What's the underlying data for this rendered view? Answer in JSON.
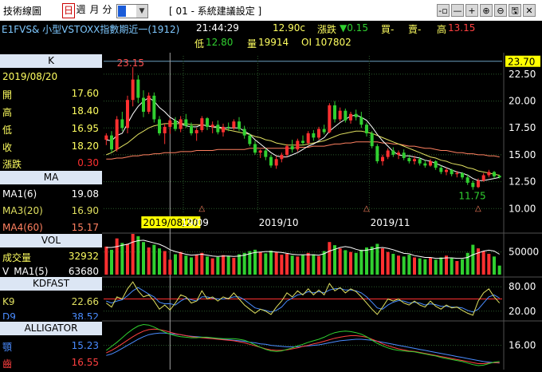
{
  "titlebar": {
    "title": "技術線圖",
    "period_day": "日",
    "period_week": "週",
    "period_month": "月",
    "period_minute": "分",
    "setting": "[ 01 - 系統建議設定 ]",
    "buttons": [
      "-▫",
      "—",
      "+",
      "⊕",
      "⊖",
      "🖫",
      "✕"
    ]
  },
  "quote": {
    "symbol": "E1FVS& 小型VSTOXX指數期近一(1912)",
    "time": "21:44:29",
    "price": "12.90c",
    "change_label": "漲跌",
    "change": "▼0.15",
    "buy": "買-",
    "sell": "賣-",
    "high_label": "高",
    "high": "13.15",
    "low_label": "低",
    "low": "12.80",
    "volume_label": "量",
    "volume": "19914",
    "oi_label": "OI",
    "oi": "107802"
  },
  "k_panel": {
    "header": "K",
    "date": "2019/08/20",
    "rows": [
      {
        "label": "開",
        "value": "17.60"
      },
      {
        "label": "高",
        "value": "18.40"
      },
      {
        "label": "低",
        "value": "16.95"
      },
      {
        "label": "收",
        "value": "18.20"
      },
      {
        "label": "漲跌",
        "value": "0.30"
      }
    ]
  },
  "ma_panel": {
    "header": "MA",
    "rows": [
      {
        "label": "MA1(6)",
        "value": "19.08"
      },
      {
        "label": "MA3(20)",
        "value": "16.90"
      },
      {
        "label": "MA4(60)",
        "value": "15.17"
      }
    ]
  },
  "vol_panel": {
    "header": "VOL",
    "rows": [
      {
        "label": "成交量",
        "value": "32932"
      },
      {
        "label": "V_MA1(5)",
        "value": "63680"
      }
    ]
  },
  "kd_panel": {
    "header": "KDFAST",
    "rows": [
      {
        "label": "K9",
        "value": "22.66"
      },
      {
        "label": "D9",
        "value": "38.52"
      }
    ]
  },
  "alligator_panel": {
    "header": "ALLIGATOR",
    "rows": [
      {
        "label": "顎",
        "value": "15.23"
      },
      {
        "label": "齒",
        "value": "16.55"
      }
    ]
  },
  "colors": {
    "up": "#ff3030",
    "down": "#30d030",
    "ma1": "#ffffff",
    "ma3": "#e0e060",
    "ma4": "#ff8060",
    "grid": "#2a5a2a",
    "axis_highlight": "#ffff00"
  },
  "chart_data": {
    "type": "candlestick",
    "price_axis": {
      "ticks": [
        "22.50",
        "20.00",
        "17.50",
        "15.00",
        "12.50",
        "10.00"
      ],
      "ylim": [
        9.5,
        24.2
      ],
      "current": "23.70"
    },
    "date_labels": [
      "2019/08/20",
      "19/09",
      "2019/10",
      "2019/11"
    ],
    "cursor_date": "2019/08/20",
    "annotation_high": "23.15",
    "annotation_low": "11.75",
    "candles": [
      [
        16.4,
        17.0,
        15.9,
        16.8
      ],
      [
        16.8,
        17.2,
        15.2,
        15.5
      ],
      [
        15.5,
        18.6,
        15.3,
        18.3
      ],
      [
        18.3,
        19.0,
        17.2,
        17.5
      ],
      [
        17.5,
        20.5,
        17.0,
        20.1
      ],
      [
        20.1,
        23.15,
        19.5,
        22.0
      ],
      [
        22.0,
        22.4,
        19.8,
        20.3
      ],
      [
        20.3,
        21.0,
        18.5,
        19.0
      ],
      [
        19.0,
        20.8,
        18.8,
        20.5
      ],
      [
        20.5,
        20.8,
        18.0,
        18.3
      ],
      [
        18.3,
        18.6,
        16.8,
        17.0
      ],
      [
        17.0,
        17.9,
        16.0,
        17.6
      ],
      [
        17.6,
        18.4,
        16.95,
        18.2
      ],
      [
        18.2,
        18.5,
        17.2,
        17.4
      ],
      [
        17.4,
        18.6,
        17.1,
        18.3
      ],
      [
        18.3,
        18.8,
        17.5,
        17.7
      ],
      [
        17.7,
        18.0,
        16.8,
        17.0
      ],
      [
        17.0,
        17.5,
        16.3,
        17.3
      ],
      [
        17.3,
        18.6,
        17.1,
        18.4
      ],
      [
        18.4,
        18.5,
        17.3,
        17.6
      ],
      [
        17.6,
        18.1,
        17.0,
        17.8
      ],
      [
        17.8,
        18.2,
        16.9,
        17.1
      ],
      [
        17.1,
        17.9,
        16.7,
        17.6
      ],
      [
        17.6,
        18.0,
        17.2,
        17.5
      ],
      [
        17.5,
        18.3,
        17.3,
        18.1
      ],
      [
        18.1,
        18.5,
        17.2,
        17.4
      ],
      [
        17.4,
        17.7,
        16.5,
        16.8
      ],
      [
        16.8,
        17.0,
        15.8,
        16.0
      ],
      [
        16.0,
        16.3,
        15.0,
        15.2
      ],
      [
        15.2,
        15.5,
        14.7,
        15.4
      ],
      [
        15.4,
        15.6,
        14.5,
        14.8
      ],
      [
        14.8,
        15.0,
        13.8,
        14.0
      ],
      [
        14.0,
        14.9,
        13.7,
        14.6
      ],
      [
        14.6,
        15.2,
        14.3,
        15.0
      ],
      [
        15.0,
        16.0,
        14.8,
        15.8
      ],
      [
        15.8,
        16.4,
        15.2,
        15.5
      ],
      [
        15.5,
        16.5,
        15.3,
        16.3
      ],
      [
        16.3,
        16.8,
        15.9,
        16.1
      ],
      [
        16.1,
        17.2,
        15.9,
        17.0
      ],
      [
        17.0,
        17.3,
        16.3,
        16.6
      ],
      [
        16.6,
        17.6,
        16.4,
        17.4
      ],
      [
        17.4,
        17.8,
        16.9,
        17.1
      ],
      [
        17.1,
        19.8,
        17.0,
        19.6
      ],
      [
        19.6,
        20.0,
        18.0,
        18.3
      ],
      [
        18.3,
        19.4,
        18.1,
        19.1
      ],
      [
        19.1,
        19.3,
        18.0,
        18.2
      ],
      [
        18.2,
        19.0,
        17.9,
        18.8
      ],
      [
        18.8,
        19.2,
        18.2,
        18.5
      ],
      [
        18.5,
        19.0,
        17.5,
        17.8
      ],
      [
        17.8,
        18.0,
        16.7,
        17.0
      ],
      [
        17.0,
        17.2,
        15.6,
        15.8
      ],
      [
        15.8,
        16.0,
        14.2,
        14.4
      ],
      [
        14.4,
        15.0,
        14.0,
        14.8
      ],
      [
        14.8,
        15.6,
        14.6,
        15.4
      ],
      [
        15.4,
        15.7,
        14.8,
        15.0
      ],
      [
        15.0,
        15.4,
        14.6,
        15.2
      ],
      [
        15.2,
        15.5,
        14.5,
        14.7
      ],
      [
        14.7,
        15.0,
        14.2,
        14.4
      ],
      [
        14.4,
        14.9,
        14.1,
        14.6
      ],
      [
        14.6,
        14.8,
        14.0,
        14.2
      ],
      [
        14.2,
        14.5,
        13.8,
        14.0
      ],
      [
        14.0,
        14.6,
        13.9,
        14.4
      ],
      [
        14.4,
        14.5,
        13.6,
        13.8
      ],
      [
        13.8,
        14.0,
        13.2,
        13.4
      ],
      [
        13.4,
        13.8,
        13.1,
        13.6
      ],
      [
        13.6,
        13.7,
        13.0,
        13.2
      ],
      [
        13.2,
        13.5,
        12.9,
        13.3
      ],
      [
        13.3,
        13.4,
        12.7,
        12.9
      ],
      [
        12.9,
        13.2,
        12.2,
        12.4
      ],
      [
        12.4,
        12.6,
        11.75,
        12.0
      ],
      [
        12.0,
        12.8,
        11.9,
        12.6
      ],
      [
        12.6,
        13.3,
        12.5,
        13.1
      ],
      [
        13.1,
        13.6,
        12.9,
        13.4
      ],
      [
        13.4,
        13.5,
        12.8,
        13.0
      ],
      [
        13.05,
        13.15,
        12.8,
        12.9
      ]
    ],
    "ma1": [
      16.4,
      16.3,
      16.8,
      17.0,
      17.9,
      18.8,
      19.5,
      20.0,
      20.3,
      20.0,
      19.4,
      19.0,
      18.5,
      18.2,
      17.9,
      17.7,
      17.6,
      17.6,
      17.8,
      17.7,
      17.6,
      17.6,
      17.5,
      17.5,
      17.5,
      17.5,
      17.2,
      16.9,
      16.4,
      16.0,
      15.6,
      15.2,
      14.9,
      14.8,
      14.8,
      15.0,
      15.2,
      15.5,
      15.8,
      16.0,
      16.3,
      16.6,
      17.2,
      17.6,
      18.0,
      18.3,
      18.6,
      18.7,
      18.5,
      18.2,
      17.6,
      16.9,
      16.3,
      15.8,
      15.3,
      15.0,
      14.9,
      14.9,
      14.8,
      14.7,
      14.5,
      14.4,
      14.2,
      14.0,
      13.8,
      13.6,
      13.4,
      13.3,
      13.1,
      12.8,
      12.6,
      12.6,
      12.7,
      12.8,
      12.9
    ],
    "ma3": [
      15.0,
      15.2,
      15.5,
      15.8,
      16.1,
      16.5,
      16.9,
      17.2,
      17.5,
      17.7,
      17.8,
      17.9,
      17.9,
      17.9,
      17.9,
      17.9,
      17.8,
      17.8,
      17.8,
      17.7,
      17.6,
      17.5,
      17.4,
      17.3,
      17.2,
      17.1,
      17.0,
      16.9,
      16.7,
      16.6,
      16.4,
      16.3,
      16.1,
      16.0,
      15.9,
      15.9,
      15.9,
      15.9,
      16.0,
      16.1,
      16.2,
      16.3,
      16.5,
      16.7,
      16.9,
      17.0,
      17.1,
      17.2,
      17.2,
      17.1,
      17.0,
      16.8,
      16.6,
      16.4,
      16.2,
      16.0,
      15.8,
      15.6,
      15.4,
      15.2,
      15.0,
      14.8,
      14.7,
      14.5,
      14.4,
      14.2,
      14.1,
      14.0,
      13.8,
      13.7,
      13.5,
      13.4,
      13.3,
      13.2,
      13.1
    ],
    "ma4": [
      14.6,
      14.6,
      14.7,
      14.7,
      14.8,
      14.9,
      14.9,
      15.0,
      15.0,
      15.1,
      15.1,
      15.2,
      15.2,
      15.2,
      15.3,
      15.3,
      15.3,
      15.4,
      15.4,
      15.4,
      15.4,
      15.5,
      15.5,
      15.5,
      15.5,
      15.5,
      15.5,
      15.6,
      15.6,
      15.6,
      15.6,
      15.6,
      15.6,
      15.6,
      15.6,
      15.6,
      15.7,
      15.7,
      15.7,
      15.8,
      15.8,
      15.8,
      15.9,
      16.0,
      16.0,
      16.1,
      16.1,
      16.2,
      16.2,
      16.2,
      16.2,
      16.2,
      16.1,
      16.1,
      16.0,
      16.0,
      15.9,
      15.8,
      15.8,
      15.7,
      15.6,
      15.6,
      15.5,
      15.4,
      15.4,
      15.3,
      15.2,
      15.2,
      15.1,
      15.1,
      15.0,
      15.0,
      14.9,
      14.9,
      14.8
    ],
    "volume_axis": {
      "tick": "50000",
      "max": 90000
    },
    "volume": [
      62000,
      55000,
      80000,
      70000,
      68000,
      90000,
      85000,
      72000,
      60000,
      66000,
      58000,
      52000,
      32932,
      45000,
      50000,
      42000,
      38000,
      44000,
      48000,
      40000,
      36000,
      39000,
      43000,
      41000,
      37000,
      45000,
      48000,
      52000,
      55000,
      50000,
      47000,
      53000,
      49000,
      44000,
      46000,
      42000,
      40000,
      43000,
      48000,
      45000,
      41000,
      52000,
      72000,
      65000,
      58000,
      54000,
      50000,
      48000,
      55000,
      60000,
      62000,
      68000,
      58000,
      50000,
      46000,
      42000,
      40000,
      44000,
      38000,
      36000,
      34000,
      37000,
      33000,
      38000,
      42000,
      36000,
      30000,
      34000,
      48000,
      66000,
      58000,
      52000,
      46000,
      40000,
      19914
    ],
    "vol_ma": [
      60000,
      60000,
      62000,
      65000,
      67000,
      72000,
      75000,
      76000,
      73000,
      70000,
      67000,
      62000,
      55000,
      51000,
      48000,
      45000,
      43000,
      44000,
      45000,
      43000,
      41000,
      40000,
      41000,
      41000,
      40000,
      41000,
      43000,
      46000,
      49000,
      50000,
      51000,
      51000,
      50000,
      49000,
      47000,
      45000,
      44000,
      44000,
      44000,
      44000,
      43000,
      46000,
      52000,
      56000,
      60000,
      62000,
      60000,
      56000,
      53000,
      54000,
      56000,
      59000,
      60000,
      58000,
      55000,
      51000,
      47000,
      46000,
      42000,
      40000,
      38000,
      38000,
      36000,
      36000,
      37000,
      37000,
      36000,
      36000,
      38000,
      44000,
      48000,
      52000,
      54000,
      52000,
      45000
    ],
    "kd_axis": {
      "ticks": [
        "80.00",
        "20.00"
      ],
      "red_line": 50
    },
    "k9": [
      40,
      30,
      55,
      50,
      75,
      92,
      70,
      55,
      60,
      45,
      25,
      35,
      22.66,
      40,
      60,
      55,
      40,
      45,
      70,
      50,
      55,
      45,
      55,
      50,
      65,
      50,
      35,
      25,
      15,
      25,
      20,
      12,
      30,
      45,
      65,
      55,
      70,
      60,
      75,
      60,
      72,
      60,
      88,
      70,
      78,
      65,
      75,
      68,
      55,
      40,
      25,
      12,
      30,
      50,
      45,
      50,
      40,
      35,
      45,
      35,
      30,
      45,
      32,
      25,
      35,
      28,
      30,
      22,
      15,
      10,
      45,
      65,
      75,
      55,
      40
    ],
    "d9": [
      45,
      40,
      45,
      48,
      58,
      70,
      78,
      70,
      62,
      55,
      42,
      38,
      38.52,
      35,
      45,
      52,
      48,
      45,
      55,
      55,
      52,
      50,
      50,
      52,
      55,
      55,
      48,
      38,
      28,
      25,
      22,
      18,
      22,
      30,
      45,
      52,
      60,
      62,
      68,
      65,
      68,
      65,
      72,
      75,
      76,
      72,
      72,
      70,
      65,
      55,
      42,
      28,
      25,
      35,
      42,
      46,
      45,
      40,
      42,
      40,
      35,
      38,
      36,
      32,
      32,
      30,
      30,
      28,
      22,
      18,
      25,
      40,
      55,
      60,
      52
    ],
    "alligator_axis": {
      "tick": "16.00",
      "ylim": [
        12.0,
        20.5
      ]
    },
    "jaw": [
      14.0,
      14.3,
      14.8,
      15.4,
      16.0,
      16.6,
      17.2,
      17.7,
      18.1,
      18.3,
      18.4,
      18.4,
      18.3,
      18.2,
      18.1,
      17.9,
      17.8,
      17.7,
      17.6,
      17.5,
      17.4,
      17.3,
      17.2,
      17.1,
      17.0,
      16.9,
      16.8,
      16.6,
      16.5,
      16.3,
      16.2,
      16.0,
      15.9,
      15.8,
      15.7,
      15.7,
      15.7,
      15.8,
      15.9,
      16.0,
      16.1,
      16.3,
      16.5,
      16.7,
      16.9,
      17.0,
      17.1,
      17.2,
      17.2,
      17.1,
      17.0,
      16.8,
      16.6,
      16.4,
      16.2,
      16.0,
      15.8,
      15.6,
      15.4,
      15.2,
      15.0,
      14.8,
      14.6,
      14.4,
      14.2,
      14.0,
      13.8,
      13.6,
      13.4,
      13.2,
      13.0,
      12.8,
      12.7,
      12.6,
      12.5
    ],
    "teeth": [
      14.5,
      15.0,
      15.6,
      16.3,
      17.0,
      17.7,
      18.3,
      18.8,
      19.1,
      19.2,
      19.1,
      18.9,
      18.6,
      18.3,
      18.1,
      17.9,
      17.7,
      17.6,
      17.5,
      17.4,
      17.3,
      17.2,
      17.1,
      17.0,
      16.9,
      16.7,
      16.5,
      16.2,
      15.9,
      15.6,
      15.3,
      15.1,
      15.0,
      15.0,
      15.1,
      15.3,
      15.5,
      15.8,
      16.0,
      16.3,
      16.5,
      16.8,
      17.1,
      17.4,
      17.6,
      17.8,
      17.9,
      17.9,
      17.8,
      17.6,
      17.2,
      16.8,
      16.3,
      15.9,
      15.6,
      15.3,
      15.1,
      14.9,
      14.8,
      14.6,
      14.4,
      14.2,
      14.0,
      13.8,
      13.6,
      13.4,
      13.2,
      13.0,
      12.8,
      12.6,
      12.4,
      12.4,
      12.5,
      12.6,
      12.6
    ],
    "lips": [
      15.0,
      15.8,
      16.6,
      17.5,
      18.4,
      19.2,
      19.8,
      20.1,
      20.0,
      19.6,
      19.1,
      18.6,
      18.2,
      17.9,
      17.7,
      17.6,
      17.5,
      17.5,
      17.6,
      17.6,
      17.5,
      17.4,
      17.3,
      17.3,
      17.3,
      17.2,
      17.0,
      16.6,
      16.1,
      15.6,
      15.2,
      14.9,
      14.8,
      14.9,
      15.2,
      15.5,
      15.9,
      16.2,
      16.6,
      16.9,
      17.2,
      17.6,
      18.1,
      18.5,
      18.7,
      18.8,
      18.7,
      18.5,
      18.2,
      17.7,
      17.0,
      16.4,
      15.9,
      15.5,
      15.2,
      15.0,
      14.9,
      14.8,
      14.7,
      14.5,
      14.3,
      14.1,
      13.9,
      13.6,
      13.4,
      13.2,
      13.0,
      12.8,
      12.5,
      12.2,
      12.0,
      12.1,
      12.4,
      12.7,
      12.8
    ]
  }
}
